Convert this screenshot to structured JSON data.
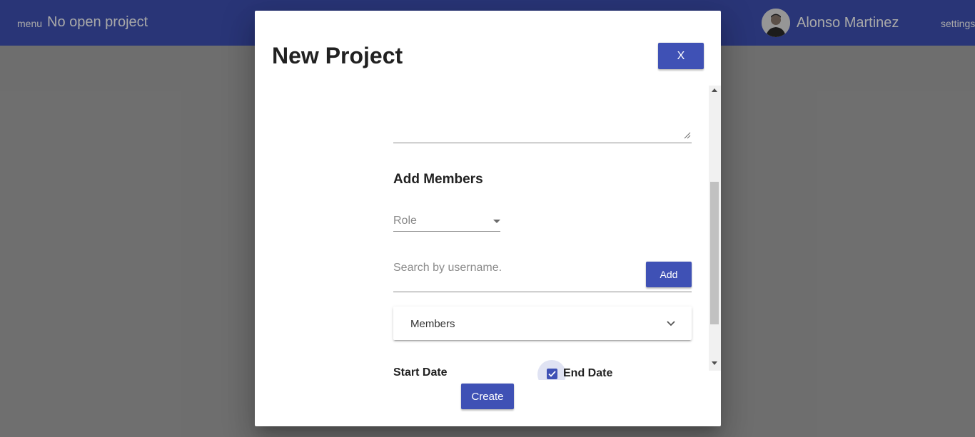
{
  "appbar": {
    "menu_label": "menu",
    "project_title": "No open project",
    "user_name": "Alonso Martinez",
    "settings_label": "settings"
  },
  "modal": {
    "title": "New Project",
    "close_label": "X",
    "add_members_heading": "Add Members",
    "role_placeholder": "Role",
    "search_placeholder": "Search by username.",
    "add_label": "Add",
    "members_label": "Members",
    "start_date_label": "Start Date",
    "end_date_label": "End Date",
    "end_date_checked": true,
    "create_label": "Create"
  },
  "colors": {
    "primary": "#3f51b5",
    "overlay": "#a8a8a8",
    "text": "#212121",
    "muted": "#8a8a8a"
  },
  "icons": [
    "menu-icon",
    "user-avatar",
    "chevron-down-icon",
    "dropdown-caret-icon",
    "check-icon",
    "resize-handle-icon"
  ]
}
